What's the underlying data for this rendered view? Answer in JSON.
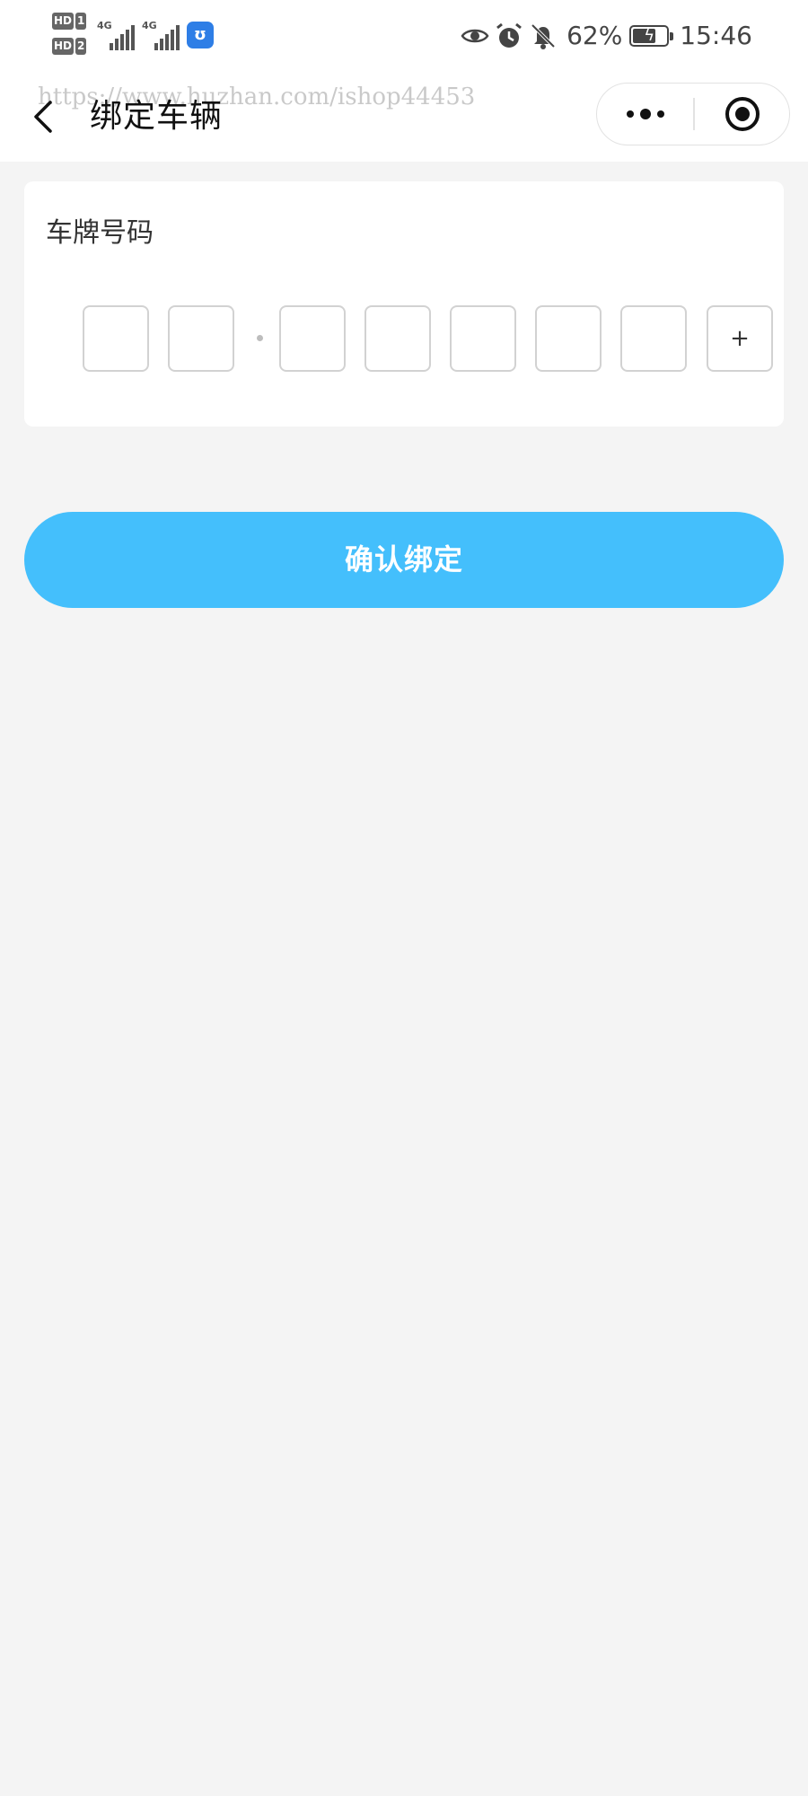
{
  "status_bar": {
    "sim1_label": "HD",
    "sim1_num": "1",
    "sim2_label": "HD",
    "sim2_num": "2",
    "network1": "4G",
    "network2": "4G",
    "battery_percent": "62%",
    "time": "15:46",
    "icons": [
      "eye-icon",
      "alarm-icon",
      "bell-muted-icon",
      "battery-charging-icon"
    ]
  },
  "nav": {
    "title": "绑定车辆",
    "watermark": "https://www.huzhan.com/ishop44453",
    "back_icon": "chevron-left-icon",
    "more_icon": "more-dots-icon",
    "close_icon": "target-circle-icon"
  },
  "plate_card": {
    "label": "车牌号码",
    "boxes": [
      "",
      "",
      "",
      "",
      "",
      "",
      "",
      "+"
    ]
  },
  "confirm": {
    "label": "确认绑定"
  },
  "colors": {
    "accent": "#44bffc",
    "background": "#f4f4f4",
    "card": "#ffffff",
    "box_border": "#d2d2d2"
  }
}
